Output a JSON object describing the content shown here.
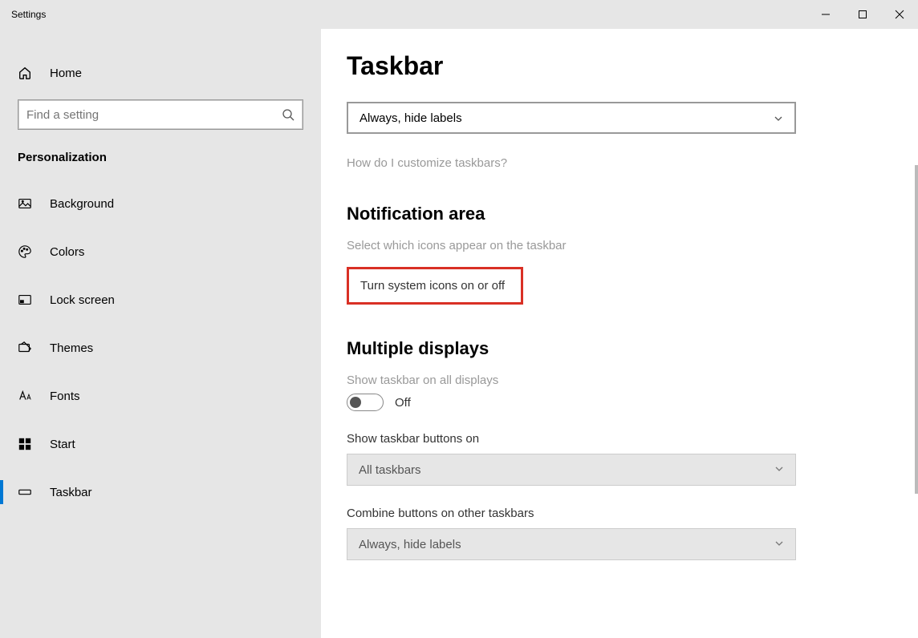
{
  "window": {
    "title": "Settings"
  },
  "sidebar": {
    "home": "Home",
    "search_placeholder": "Find a setting",
    "category": "Personalization",
    "items": [
      {
        "label": "Background"
      },
      {
        "label": "Colors"
      },
      {
        "label": "Lock screen"
      },
      {
        "label": "Themes"
      },
      {
        "label": "Fonts"
      },
      {
        "label": "Start"
      },
      {
        "label": "Taskbar"
      }
    ]
  },
  "page": {
    "title": "Taskbar",
    "combine_top_value": "Always, hide labels",
    "help_link": "How do I customize taskbars?",
    "notification_heading": "Notification area",
    "notif_link1": "Select which icons appear on the taskbar",
    "notif_link2": "Turn system icons on or off",
    "multiple_heading": "Multiple displays",
    "show_all_label": "Show taskbar on all displays",
    "show_all_state": "Off",
    "show_buttons_label": "Show taskbar buttons on",
    "show_buttons_value": "All taskbars",
    "combine_other_label": "Combine buttons on other taskbars",
    "combine_other_value": "Always, hide labels"
  }
}
